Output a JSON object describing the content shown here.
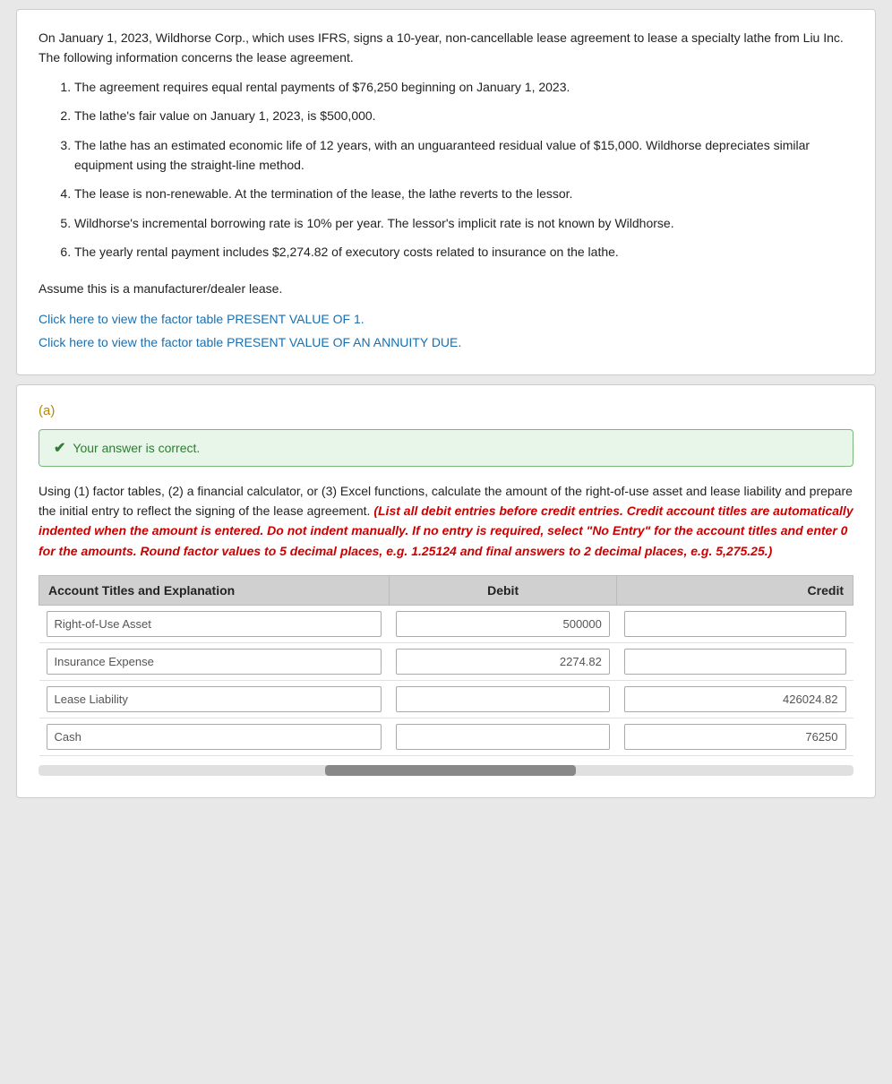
{
  "scenario": {
    "intro": "On January 1, 2023, Wildhorse Corp., which uses IFRS, signs a 10-year, non-cancellable lease agreement to lease a specialty lathe from Liu Inc. The following information concerns the lease agreement.",
    "items": [
      "The agreement requires equal rental payments of $76,250 beginning on January 1, 2023.",
      "The lathe's fair value on January 1, 2023, is $500,000.",
      "The lathe has an estimated economic life of 12 years, with an unguaranteed residual value of $15,000. Wildhorse depreciates similar equipment using the straight-line method.",
      "The lease is non-renewable. At the termination of the lease, the lathe reverts to the lessor.",
      "Wildhorse's incremental borrowing rate is 10% per year. The lessor's implicit rate is not known by Wildhorse.",
      "The yearly rental payment includes $2,274.82 of executory costs related to insurance on the lathe."
    ],
    "assume_text": "Assume this is a manufacturer/dealer lease.",
    "link1": "Click here to view the factor table PRESENT VALUE OF 1.",
    "link2": "Click here to view the factor table PRESENT VALUE OF AN ANNUITY DUE."
  },
  "part_a": {
    "label": "(a)",
    "correct_message": "Your answer is correct.",
    "instructions_normal": "Using (1) factor tables, (2) a financial calculator, or (3) Excel functions, calculate the amount of the right-of-use asset and lease liability and prepare the initial entry to reflect the signing of the lease agreement.",
    "instructions_bold": "(List all debit entries before credit entries. Credit account titles are automatically indented when the amount is entered. Do not indent manually. If no entry is required, select \"No Entry\" for the account titles and enter 0 for the amounts. Round factor values to 5 decimal places, e.g. 1.25124 and final answers to 2 decimal places, e.g. 5,275.25.)",
    "table": {
      "headers": [
        "Account Titles and Explanation",
        "Debit",
        "Credit"
      ],
      "rows": [
        {
          "account": "Right-of-Use Asset",
          "debit": "500000",
          "credit": ""
        },
        {
          "account": "Insurance Expense",
          "debit": "2274.82",
          "credit": ""
        },
        {
          "account": "Lease Liability",
          "debit": "",
          "credit": "426024.82"
        },
        {
          "account": "Cash",
          "debit": "",
          "credit": "76250"
        }
      ]
    }
  },
  "colors": {
    "link_blue": "#1a6faf",
    "correct_green": "#2e7d32",
    "correct_bg": "#e8f5e9",
    "correct_border": "#7cb87c",
    "red": "#cc0000",
    "part_label": "#b8860b"
  }
}
